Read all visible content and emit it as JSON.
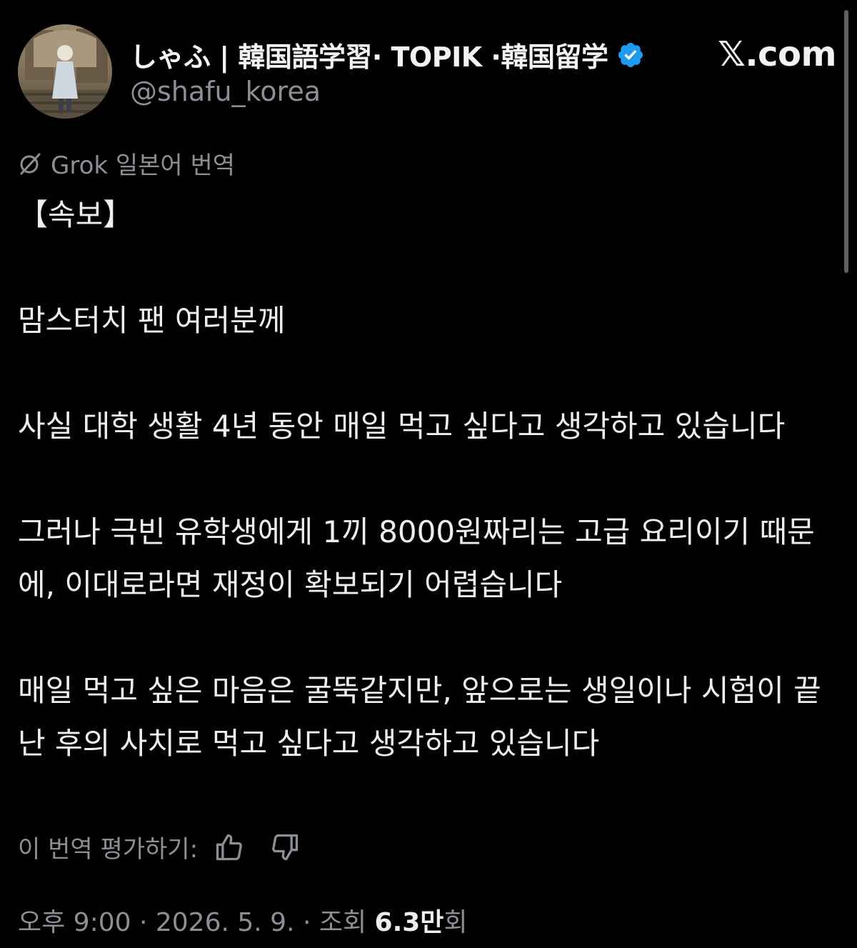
{
  "author": {
    "display_name": "しゃふ | 韓国語学習· TOPIK ·韓国留学",
    "handle": "@shafu_korea",
    "verified_icon": "verified-badge-icon",
    "verified_color": "#1d9bf0"
  },
  "brand": {
    "label": "𝕏.com"
  },
  "translation": {
    "icon": "grok-icon",
    "label": "Grok 일본어 번역"
  },
  "tweet": {
    "paragraphs": [
      "【속보】",
      "맘스터치 팬 여러분께",
      "사실 대학 생활 4년 동안 매일 먹고 싶다고 생각하고 있습니다",
      "그러나 극빈 유학생에게 1끼 8000원짜리는 고급 요리이기 때문에, 이대로라면 재정이 확보되기 어렵습니다",
      "매일 먹고 싶은 마음은 굴뚝같지만, 앞으로는 생일이나 시험이 끝난 후의 사치로 먹고 싶다고 생각하고 있습니다"
    ]
  },
  "rating": {
    "label": "이 번역 평가하기:",
    "like_icon": "thumbs-up-icon",
    "dislike_icon": "thumbs-down-icon"
  },
  "meta": {
    "timestamp": "오후 9:00 · 2026. 5. 9. · 조회 ",
    "views": "6.3만",
    "views_suffix": "회"
  },
  "colors": {
    "background": "#000000",
    "text": "#e7e9ea",
    "secondary": "#8b9096",
    "accent": "#1d9bf0"
  }
}
